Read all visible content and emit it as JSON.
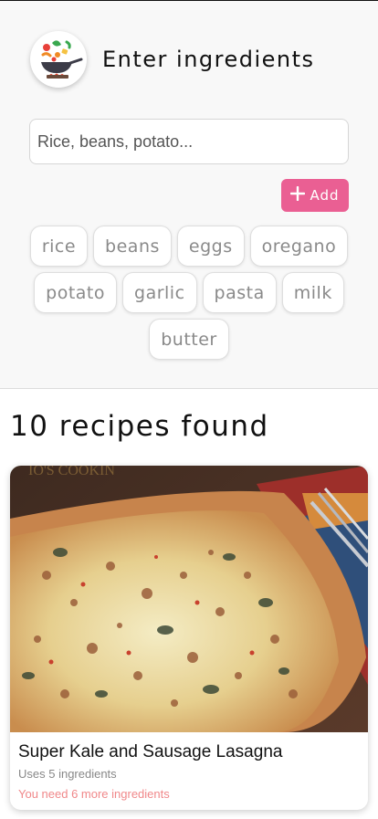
{
  "header": {
    "title": "Enter ingredients",
    "logo_icon": "cooking-wok-icon"
  },
  "search": {
    "placeholder": "Rice, beans, potato...",
    "value": ""
  },
  "add_button": {
    "label": "Add",
    "icon": "plus-icon",
    "color": "#ea5f93"
  },
  "ingredients": [
    {
      "label": "rice"
    },
    {
      "label": "beans"
    },
    {
      "label": "eggs"
    },
    {
      "label": "oregano"
    },
    {
      "label": "potato"
    },
    {
      "label": "garlic"
    },
    {
      "label": "pasta"
    },
    {
      "label": "milk"
    },
    {
      "label": "butter"
    }
  ],
  "results": {
    "heading": "10 recipes found",
    "recipes": [
      {
        "title": "Super Kale and Sausage Lasagna",
        "uses": "Uses 5 ingredients",
        "needs": "You need 6 more ingredients",
        "image": "lasagna-photo",
        "image_watermark": "IO'S COOKIN"
      }
    ]
  },
  "colors": {
    "accent": "#ea5f93",
    "needs_text": "#f0888a",
    "panel_bg": "#f8f8f8"
  }
}
